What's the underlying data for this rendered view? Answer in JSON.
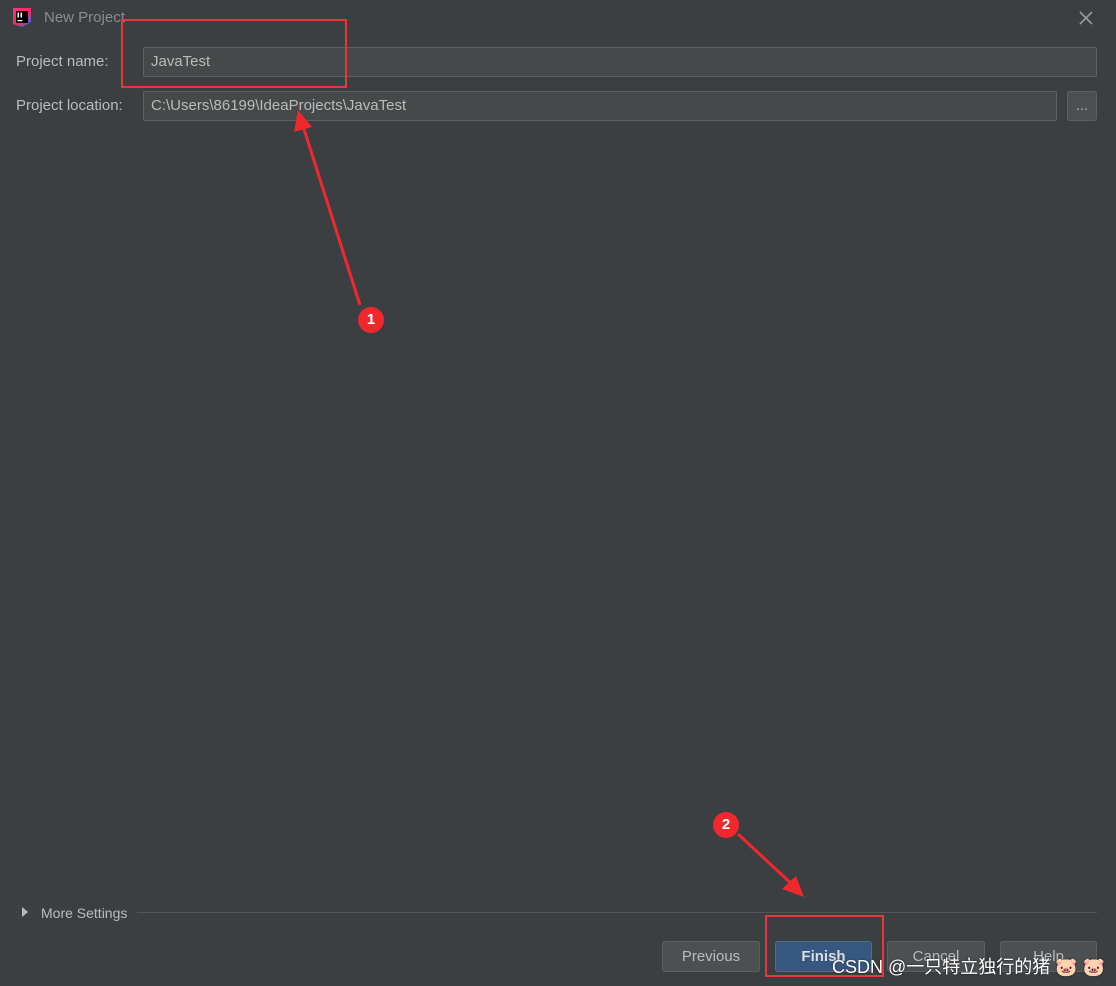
{
  "window": {
    "title": "New Project",
    "app_icon": "intellij-idea-icon",
    "close_icon": "close-icon"
  },
  "form": {
    "project_name_label": "Project name:",
    "project_name_value": "JavaTest",
    "project_location_label": "Project location:",
    "project_location_value": "C:\\Users\\86199\\IdeaProjects\\JavaTest",
    "browse_label": "..."
  },
  "more_settings": {
    "label": "More Settings",
    "icon": "triangle-right-icon"
  },
  "buttons": {
    "previous": "Previous",
    "finish": "Finish",
    "cancel": "Cancel",
    "help": "Help"
  },
  "annotations": {
    "step1": "1",
    "step2": "2",
    "color": "#e8373a"
  },
  "watermark": "CSDN @一只特立独行的猪 🐷 🐷",
  "colors": {
    "background": "#3c3f41",
    "field_background": "#45494a",
    "primary_button": "#365880",
    "text": "#bbbbbb"
  }
}
